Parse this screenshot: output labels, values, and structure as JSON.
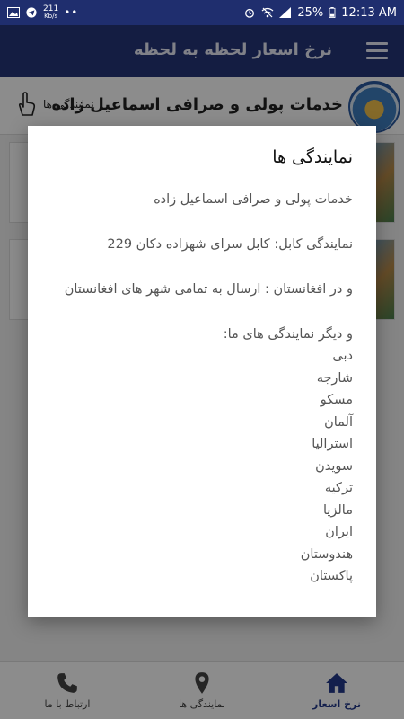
{
  "statusbar": {
    "net_speed": "211",
    "net_unit": "Kb/s",
    "battery": "25%",
    "time": "12:13 AM",
    "dots": "••"
  },
  "appbar": {
    "title": "نرخ اسعار لحظه به لحظه"
  },
  "business": {
    "name": "خدمات پولی و صرافی اسماعیل زاده",
    "representatives_link": "نمایندگی ها"
  },
  "dialog": {
    "title": "نمایندگی ها",
    "line1": "خدمات پولی و صرافی اسماعیل زاده",
    "line2": "نمایندگی کابل: کابل سرای شهزاده دکان 229",
    "line3": "و در افغانستان : ارسال به تمامی شهر های افغانستان",
    "line4": "و دیگر نمایندگی های ما:",
    "cities": [
      "دبی",
      "شارجه",
      "مسکو",
      "آلمان",
      "استرالیا",
      "سویدن",
      "ترکیه",
      "مالزیا",
      "ایران",
      "هندوستان",
      "پاکستان"
    ]
  },
  "bottom_nav": {
    "rates": "نرخ اسعار",
    "representatives": "نمایندگی ها",
    "contact": "ارتباط با ما"
  },
  "colors": {
    "primary": "#253579",
    "status": "#1f2e6e",
    "nav_active": "#233a8a"
  }
}
